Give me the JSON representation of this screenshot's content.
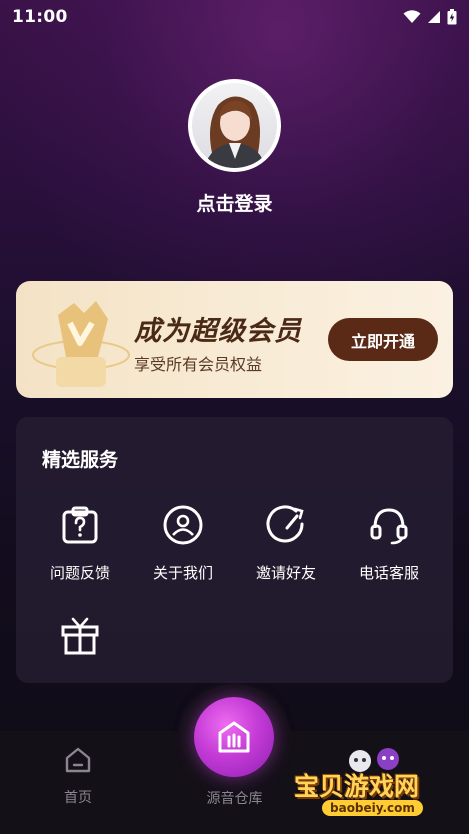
{
  "status_bar": {
    "time": "11:00"
  },
  "profile": {
    "login_label": "点击登录"
  },
  "vip": {
    "title": "成为超级会员",
    "subtitle": "享受所有会员权益",
    "button_label": "立即开通"
  },
  "services": {
    "title": "精选服务",
    "items": [
      {
        "label": "问题反馈",
        "icon": "feedback-icon"
      },
      {
        "label": "关于我们",
        "icon": "about-icon"
      },
      {
        "label": "邀请好友",
        "icon": "invite-icon"
      },
      {
        "label": "电话客服",
        "icon": "headset-icon"
      },
      {
        "label": "",
        "icon": "gift-icon"
      }
    ]
  },
  "bottom_nav": {
    "home_label": "首页",
    "center_label": "源音仓库"
  },
  "watermark": {
    "title": "宝贝游戏网",
    "url": "baobeiy.com"
  },
  "colors": {
    "accent": "#c43bd6",
    "vip_button": "#5a2a16",
    "vip_banner": "#f5e5cb"
  }
}
